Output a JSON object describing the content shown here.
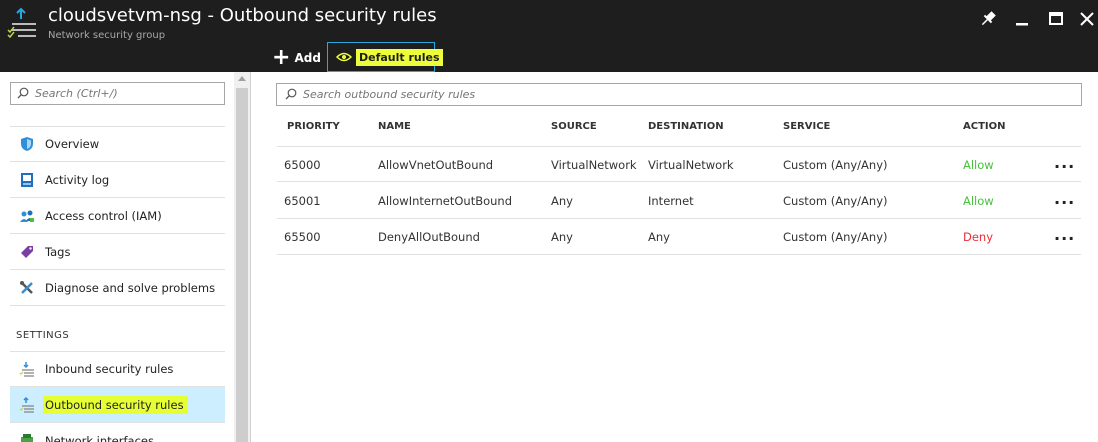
{
  "header": {
    "title": "cloudsvetvm-nsg - Outbound security rules",
    "subtitle": "Network security group",
    "add_label": "Add",
    "default_rules_label": "Default rules"
  },
  "sidebar": {
    "search_placeholder": "Search (Ctrl+/)",
    "items": [
      {
        "label": "Overview",
        "icon": "shield-icon"
      },
      {
        "label": "Activity log",
        "icon": "activity-log-icon"
      },
      {
        "label": "Access control (IAM)",
        "icon": "users-icon"
      },
      {
        "label": "Tags",
        "icon": "tag-icon"
      },
      {
        "label": "Diagnose and solve problems",
        "icon": "wrench-icon"
      }
    ],
    "settings_header": "SETTINGS",
    "settings_items": [
      {
        "label": "Inbound security rules",
        "icon": "inbound-rules-icon"
      },
      {
        "label": "Outbound security rules",
        "icon": "outbound-rules-icon",
        "active": true
      },
      {
        "label": "Network interfaces",
        "icon": "network-interface-icon"
      }
    ]
  },
  "main": {
    "search_placeholder": "Search outbound security rules",
    "columns": [
      "PRIORITY",
      "NAME",
      "SOURCE",
      "DESTINATION",
      "SERVICE",
      "ACTION"
    ],
    "rows": [
      {
        "priority": "65000",
        "name": "AllowVnetOutBound",
        "source": "VirtualNetwork",
        "destination": "VirtualNetwork",
        "service": "Custom (Any/Any)",
        "action": "Allow"
      },
      {
        "priority": "65001",
        "name": "AllowInternetOutBound",
        "source": "Any",
        "destination": "Internet",
        "service": "Custom (Any/Any)",
        "action": "Allow"
      },
      {
        "priority": "65500",
        "name": "DenyAllOutBound",
        "source": "Any",
        "destination": "Any",
        "service": "Custom (Any/Any)",
        "action": "Deny"
      }
    ],
    "more_glyph": "..."
  },
  "colors": {
    "header_bg": "#1e1e1e",
    "active_bg": "#cceeff",
    "highlight": "#e6ff33",
    "allow": "#49c13a",
    "deny": "#e82f3a"
  }
}
